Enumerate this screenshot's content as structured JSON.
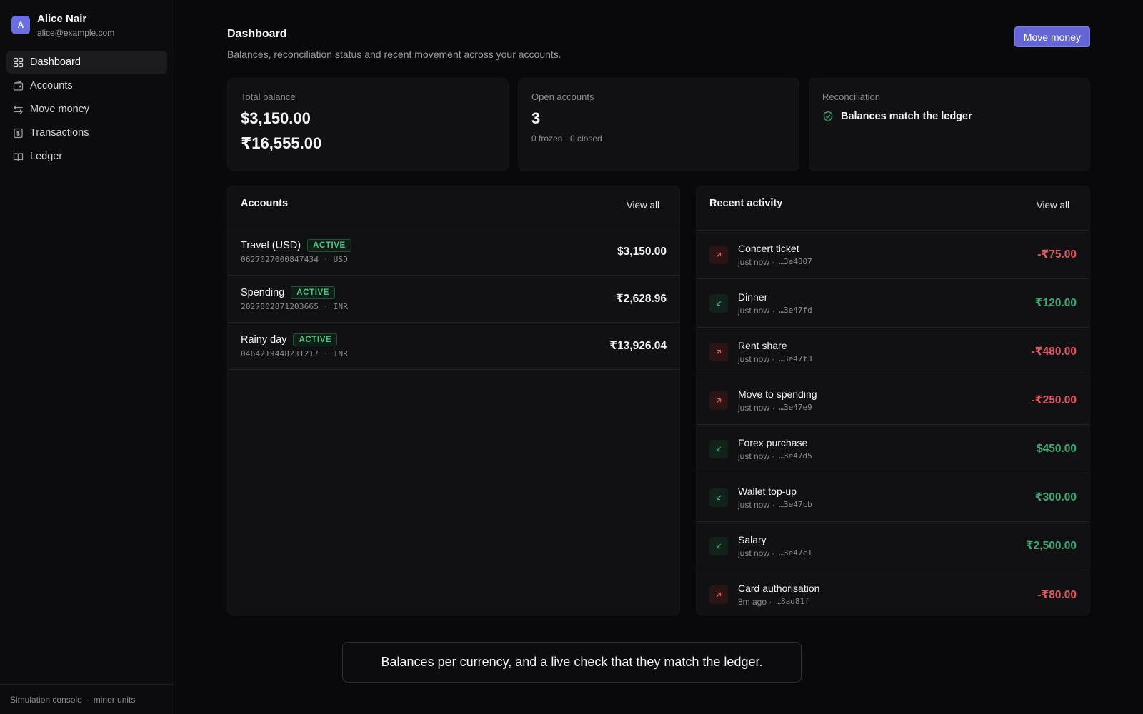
{
  "user": {
    "initial": "A",
    "name": "Alice Nair",
    "email": "alice@example.com"
  },
  "nav": [
    {
      "label": "Dashboard",
      "icon": "grid-icon",
      "active": true
    },
    {
      "label": "Accounts",
      "icon": "wallet-icon",
      "active": false
    },
    {
      "label": "Move money",
      "icon": "arrows-swap-icon",
      "active": false
    },
    {
      "label": "Transactions",
      "icon": "receipt-icon",
      "active": false
    },
    {
      "label": "Ledger",
      "icon": "book-icon",
      "active": false
    }
  ],
  "sidebar_footer": {
    "left": "Simulation console",
    "sep": "·",
    "right": "minor units"
  },
  "header": {
    "title": "Dashboard",
    "subtitle": "Balances, reconciliation status and recent movement across your accounts.",
    "primary_action": "Move money"
  },
  "stats": {
    "total_balance": {
      "label": "Total balance",
      "values": [
        "$3,150.00",
        "₹16,555.00"
      ]
    },
    "open_accounts": {
      "label": "Open accounts",
      "value": "3",
      "detail": "0 frozen · 0 closed"
    },
    "reconciliation": {
      "label": "Reconciliation",
      "status": "Balances match the ledger"
    }
  },
  "accounts_panel": {
    "title": "Accounts",
    "view_all": "View all",
    "rows": [
      {
        "name": "Travel (USD)",
        "status": "ACTIVE",
        "meta": "0627027000847434 · USD",
        "balance": "$3,150.00"
      },
      {
        "name": "Spending",
        "status": "ACTIVE",
        "meta": "2027802871203665 · INR",
        "balance": "₹2,628.96"
      },
      {
        "name": "Rainy day",
        "status": "ACTIVE",
        "meta": "0464219448231217 · INR",
        "balance": "₹13,926.04"
      }
    ]
  },
  "activity_panel": {
    "title": "Recent activity",
    "view_all": "View all",
    "rows": [
      {
        "title": "Concert ticket",
        "time": "just now ·",
        "ref": "…3e4807",
        "amount": "-₹75.00",
        "direction": "out"
      },
      {
        "title": "Dinner",
        "time": "just now ·",
        "ref": "…3e47fd",
        "amount": "₹120.00",
        "direction": "in"
      },
      {
        "title": "Rent share",
        "time": "just now ·",
        "ref": "…3e47f3",
        "amount": "-₹480.00",
        "direction": "out"
      },
      {
        "title": "Move to spending",
        "time": "just now ·",
        "ref": "…3e47e9",
        "amount": "-₹250.00",
        "direction": "out"
      },
      {
        "title": "Forex purchase",
        "time": "just now ·",
        "ref": "…3e47d5",
        "amount": "$450.00",
        "direction": "in"
      },
      {
        "title": "Wallet top-up",
        "time": "just now ·",
        "ref": "…3e47cb",
        "amount": "₹300.00",
        "direction": "in"
      },
      {
        "title": "Salary",
        "time": "just now ·",
        "ref": "…3e47c1",
        "amount": "₹2,500.00",
        "direction": "in"
      },
      {
        "title": "Card authorisation",
        "time": "8m ago ·",
        "ref": "…8ad81f",
        "amount": "-₹80.00",
        "direction": "out"
      }
    ]
  },
  "caption": "Balances per currency, and a live check that they match the ledger.",
  "colors": {
    "accent": "#6466d6",
    "positive": "#3ea774",
    "negative": "#e0575d",
    "background": "#09090b"
  }
}
